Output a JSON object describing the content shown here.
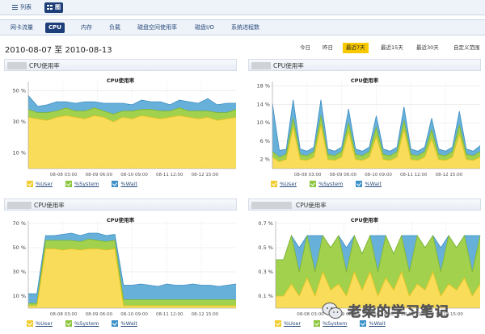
{
  "view_switch": {
    "list_label": "列表",
    "chart_label": "图"
  },
  "tabs": [
    {
      "label": "网卡流量",
      "active": false
    },
    {
      "label": "CPU",
      "active": true
    },
    {
      "label": "内存",
      "active": false
    },
    {
      "label": "负载",
      "active": false
    },
    {
      "label": "磁盘空间使用率",
      "active": false
    },
    {
      "label": "磁盘I/O",
      "active": false
    },
    {
      "label": "系统进程数",
      "active": false
    }
  ],
  "date_range": "2010-08-07 至 2010-08-13",
  "periods": [
    {
      "label": "今日",
      "active": false
    },
    {
      "label": "昨日",
      "active": false
    },
    {
      "label": "最近7天",
      "active": true
    },
    {
      "label": "最近15天",
      "active": false
    },
    {
      "label": "最近30天",
      "active": false
    },
    {
      "label": "自定义范围",
      "active": false
    }
  ],
  "colors": {
    "user": "#f7d94c",
    "system": "#9acd3e",
    "wait": "#5aa9d6",
    "tab_active": "#1e3f7a",
    "period_active": "#f9c900"
  },
  "panels": [
    {
      "header_title": "CPU使用率"
    },
    {
      "header_title": "CPU使用率"
    },
    {
      "header_title": "CPU使用率"
    },
    {
      "header_title": "CPU使用率"
    }
  ],
  "chart_data": [
    {
      "type": "area",
      "title": "CPU使用率",
      "x_ticks": [
        "08-08 03:00",
        "08-09 06:00",
        "08-10 09:00",
        "08-11 12:00",
        "08-12 15:00"
      ],
      "y_ticks": [
        "10 %",
        "30 %",
        "50 %"
      ],
      "ylim": [
        0,
        56
      ],
      "legend": [
        "%User",
        "%System",
        "%Wait"
      ],
      "series": [
        {
          "name": "%User",
          "values": [
            33,
            32,
            31,
            33,
            34,
            33,
            32,
            34,
            33,
            30,
            33,
            32,
            34,
            33,
            32,
            33,
            34,
            33,
            32,
            33,
            31,
            32,
            33
          ]
        },
        {
          "name": "%System",
          "values": [
            5,
            4,
            5,
            4,
            5,
            4,
            5,
            5,
            4,
            5,
            4,
            5,
            4,
            5,
            5,
            4,
            5,
            4,
            5,
            4,
            5,
            4,
            5
          ]
        },
        {
          "name": "%Wait",
          "values": [
            9,
            4,
            5,
            6,
            4,
            5,
            6,
            4,
            5,
            7,
            5,
            4,
            6,
            5,
            6,
            4,
            5,
            6,
            5,
            8,
            5,
            6,
            4
          ]
        }
      ]
    },
    {
      "type": "area",
      "title": "CPU使用率",
      "x_ticks": [
        "08-08 03:00",
        "08-09 06:00",
        "08-10 09:00",
        "08-11 12:00",
        "08-12 15:00"
      ],
      "y_ticks": [
        "2 %",
        "6 %",
        "10 %",
        "14 %",
        "18 %"
      ],
      "ylim": [
        0,
        19
      ],
      "legend": [
        "%User",
        "%System",
        "%Wait"
      ],
      "series": [
        {
          "name": "%User",
          "values": [
            2.5,
            1.5,
            2,
            9,
            2,
            1.8,
            2.5,
            9.5,
            2,
            1.8,
            2.5,
            8,
            2,
            1.8,
            2.5,
            7,
            2,
            1.8,
            2.5,
            8.5,
            2,
            1.8,
            2.5,
            6.5,
            2,
            1.8,
            2.5,
            7.5,
            2,
            1.8,
            2.5
          ]
        },
        {
          "name": "%System",
          "values": [
            1.2,
            1,
            1.2,
            2,
            1.1,
            1,
            1.2,
            2,
            1.1,
            1,
            1.2,
            2,
            1.1,
            1,
            1.2,
            2,
            1.1,
            1,
            1.2,
            2,
            1.1,
            1,
            1.2,
            2,
            1.1,
            1,
            1.2,
            2,
            1.1,
            1,
            1.2
          ]
        },
        {
          "name": "%Wait",
          "values": [
            10.5,
            1.5,
            1,
            4,
            1.2,
            1,
            1,
            3.5,
            1.2,
            1,
            1,
            3,
            1.2,
            1,
            1,
            2.5,
            1.2,
            1,
            1,
            3,
            1.2,
            1,
            1,
            2.5,
            1.2,
            1,
            1,
            3,
            1.2,
            1,
            1.3
          ]
        }
      ]
    },
    {
      "type": "area",
      "title": "CPU使用率",
      "x_ticks": [
        "08-08 03:00",
        "08-09 06:00",
        "08-10 09:00",
        "08-11 12:00",
        "08-12 15:00"
      ],
      "y_ticks": [
        "10 %",
        "30 %",
        "50 %",
        "70 %"
      ],
      "ylim": [
        0,
        72
      ],
      "legend": [
        "%User",
        "%System",
        "%Wait"
      ],
      "series": [
        {
          "name": "%User",
          "values": [
            2,
            2,
            49,
            49,
            48,
            49,
            48,
            49,
            49,
            48,
            49,
            2,
            2,
            2,
            2,
            2,
            2,
            2,
            2,
            2,
            2,
            2,
            2,
            2,
            2
          ]
        },
        {
          "name": "%System",
          "values": [
            2,
            2,
            7,
            7,
            8,
            7,
            7,
            8,
            7,
            7,
            7,
            5,
            5,
            5,
            5,
            5,
            5,
            5,
            5,
            5,
            5,
            5,
            5,
            5,
            5
          ]
        },
        {
          "name": "%Wait",
          "values": [
            8,
            8,
            4,
            4,
            5,
            6,
            5,
            5,
            6,
            5,
            5,
            12,
            12,
            13,
            12,
            11,
            13,
            12,
            12,
            13,
            12,
            12,
            11,
            12,
            13
          ]
        }
      ]
    },
    {
      "type": "area",
      "title": "CPU使用率",
      "x_ticks": [
        "08-08 03:00",
        "08-09 06:00",
        "08-10 09:00",
        "08-11 12:00",
        "08-12 15:00"
      ],
      "y_ticks": [
        "0.1 %",
        "0.3 %",
        "0.5 %",
        "0.7 %"
      ],
      "ylim": [
        0,
        0.72
      ],
      "legend": [
        "%User",
        "%System",
        "%Wait"
      ],
      "series": [
        {
          "name": "%User",
          "values": [
            0.1,
            0.1,
            0.2,
            0.1,
            0.25,
            0.1,
            0.3,
            0.15,
            0.2,
            0.1,
            0.3,
            0.15,
            0.3,
            0.1,
            0.25,
            0.15,
            0.3,
            0.1,
            0.2,
            0.15,
            0.3,
            0.1,
            0.2,
            0.15,
            0.25,
            0.1,
            0.2
          ]
        },
        {
          "name": "%System",
          "values": [
            0.3,
            0.3,
            0.4,
            0.2,
            0.35,
            0.2,
            0.3,
            0.35,
            0.4,
            0.2,
            0.3,
            0.3,
            0.3,
            0.2,
            0.35,
            0.3,
            0.3,
            0.2,
            0.4,
            0.35,
            0.3,
            0.2,
            0.4,
            0.35,
            0.35,
            0.2,
            0.4
          ]
        },
        {
          "name": "%Wait",
          "values": [
            0,
            0,
            0,
            0.2,
            0,
            0.3,
            0,
            0,
            0,
            0.2,
            0,
            0,
            0,
            0.3,
            0,
            0,
            0,
            0.3,
            0,
            0,
            0,
            0.2,
            0,
            0,
            0,
            0.3,
            0
          ]
        }
      ]
    }
  ],
  "watermark": {
    "text": "老柴的学习笔记"
  }
}
